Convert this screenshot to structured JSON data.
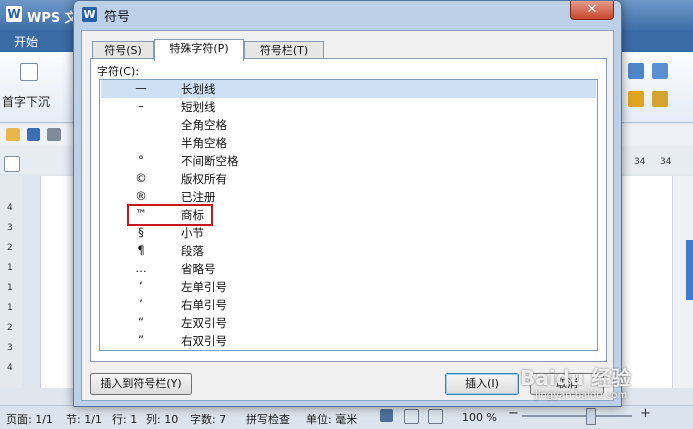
{
  "app": {
    "title": "WPS 文",
    "logo": "W",
    "tab_start": "开始",
    "ribbon_text": "首字下沉"
  },
  "ruler": {
    "right_a": "34",
    "right_b": "34"
  },
  "vertical_ruler": [
    "4",
    "3",
    "2",
    "1",
    "1",
    "1",
    "2",
    "3",
    "4"
  ],
  "dialog": {
    "title": "符号",
    "logo": "W",
    "close_glyph": "✕",
    "tabs": [
      {
        "label": "符号(S)",
        "active": false
      },
      {
        "label": "特殊字符(P)",
        "active": true
      },
      {
        "label": "符号栏(T)",
        "active": false
      }
    ],
    "char_label": "字符(C):",
    "rows": [
      {
        "symbol": "—",
        "name": "长划线",
        "selected": true
      },
      {
        "symbol": "–",
        "name": "短划线"
      },
      {
        "symbol": "",
        "name": "全角空格"
      },
      {
        "symbol": "",
        "name": "半角空格"
      },
      {
        "symbol": "°",
        "name": "不间断空格"
      },
      {
        "symbol": "©",
        "name": "版权所有"
      },
      {
        "symbol": "®",
        "name": "已注册"
      },
      {
        "symbol": "™",
        "name": "商标",
        "highlighted": true
      },
      {
        "symbol": "§",
        "name": "小节"
      },
      {
        "symbol": "¶",
        "name": "段落"
      },
      {
        "symbol": "…",
        "name": "省略号"
      },
      {
        "symbol": "‘",
        "name": "左单引号"
      },
      {
        "symbol": "’",
        "name": "右单引号"
      },
      {
        "symbol": "“",
        "name": "左双引号"
      },
      {
        "symbol": "”",
        "name": "右双引号"
      }
    ],
    "insert_to_bar_label": "插入到符号栏(Y)",
    "insert_label": "插入(I)",
    "cancel_label": "取消"
  },
  "status": {
    "page": "页面: 1/1",
    "section": "节: 1/1",
    "line": "行: 1",
    "column": "列: 10",
    "words": "字数: 7",
    "spellcheck": "拼写检查",
    "unit": "单位: 毫米",
    "zoom": "100 %"
  },
  "watermark": {
    "main": "Baidu 经验",
    "sub": "jingyan.baidu.com"
  },
  "colors": {
    "title_blue": "#3f6fa8",
    "highlight_red": "#c8161d",
    "selection": "#cfe0f5"
  }
}
